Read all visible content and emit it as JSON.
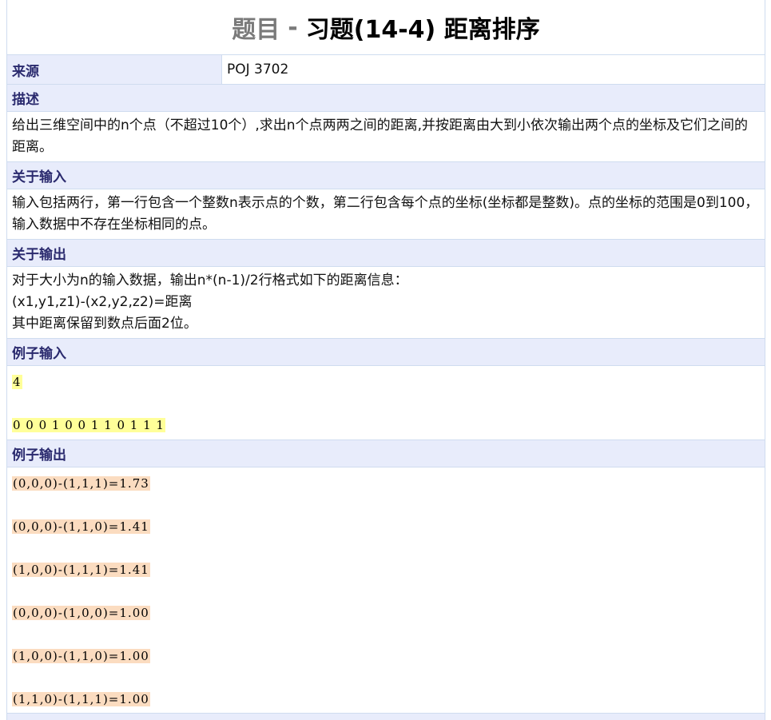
{
  "title": {
    "prefix": "题目",
    "separator": "-",
    "main": "习题(14-4) 距离排序"
  },
  "source": {
    "label": "来源",
    "value": "POJ 3702"
  },
  "description": {
    "label": "描述",
    "text": "给出三维空间中的n个点（不超过10个）,求出n个点两两之间的距离,并按距离由大到小依次输出两个点的坐标及它们之间的距离。"
  },
  "input_spec": {
    "label": "关于输入",
    "text": "输入包括两行，第一行包含一个整数n表示点的个数，第二行包含每个点的坐标(坐标都是整数)。点的坐标的范围是0到100，输入数据中不存在坐标相同的点。"
  },
  "output_spec": {
    "label": "关于输出",
    "lines": [
      "对于大小为n的输入数据，输出n*(n-1)/2行格式如下的距离信息：",
      "(x1,y1,z1)-(x2,y2,z2)=距离",
      "其中距离保留到数点后面2位。"
    ]
  },
  "sample_input": {
    "label": "例子输入",
    "lines": [
      "4",
      "0 0 0 1 0 0 1 1 0 1 1 1"
    ]
  },
  "sample_output": {
    "label": "例子输出",
    "lines": [
      "(0,0,0)-(1,1,1)=1.73",
      "(0,0,0)-(1,1,0)=1.41",
      "(1,0,0)-(1,1,1)=1.41",
      "(0,0,0)-(1,0,0)=1.00",
      "(1,0,0)-(1,1,0)=1.00",
      "(1,1,0)-(1,1,1)=1.00"
    ]
  },
  "colors": {
    "section_bg": "#e8ecfb",
    "section_text": "#2a2a6e",
    "input_highlight": "#ffff99",
    "output_highlight": "#fbdcc0"
  }
}
